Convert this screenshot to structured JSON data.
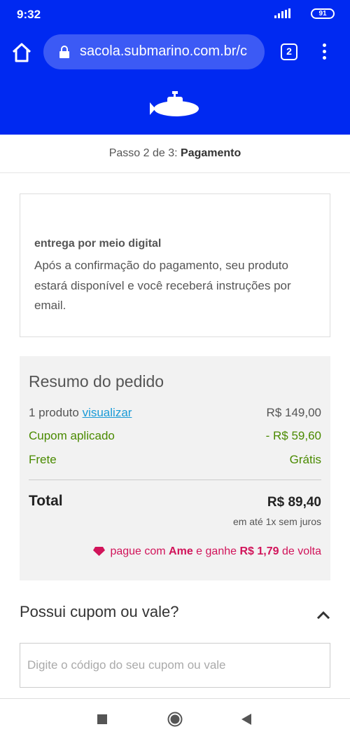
{
  "status": {
    "time": "9:32",
    "battery": "91"
  },
  "browser": {
    "url": "sacola.submarino.com.br/c",
    "tab_count": "2"
  },
  "checkout": {
    "step_prefix": "Passo 2 de 3: ",
    "step_name": "Pagamento",
    "delivery_title": "entrega por meio digital",
    "delivery_text": "Após a confirmação do pagamento, seu produto estará disponível e você receberá instruções por email."
  },
  "summary": {
    "title": "Resumo do pedido",
    "product_count": "1 produto",
    "view_link": "visualizar",
    "product_price": "R$ 149,00",
    "coupon_label": "Cupom aplicado",
    "coupon_value": "- R$ 59,60",
    "shipping_label": "Frete",
    "shipping_value": "Grátis",
    "total_label": "Total",
    "total_value": "R$ 89,40",
    "installments": "em até 1x sem juros",
    "ame_prefix": "pague com ",
    "ame_brand": "Ame",
    "ame_mid": " e ganhe ",
    "ame_amount": "R$ 1,79",
    "ame_suffix": " de volta"
  },
  "coupon": {
    "title": "Possui cupom ou vale?",
    "placeholder": "Digite o código do seu cupom ou vale"
  },
  "colors": {
    "brand_blue": "#0029f1",
    "ame_pink": "#d1145a",
    "green": "#4a8a00",
    "link_blue": "#1a9bd7"
  }
}
